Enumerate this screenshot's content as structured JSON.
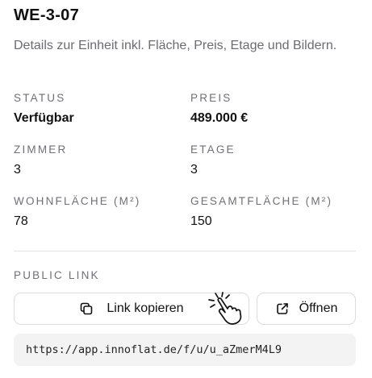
{
  "unit": {
    "title": "WE-3-07",
    "description": "Details zur Einheit inkl. Fläche, Preis, Etage und Bildern."
  },
  "fields": {
    "status": {
      "label": "STATUS",
      "value": "Verfügbar"
    },
    "price": {
      "label": "PREIS",
      "value": "489.000 €"
    },
    "rooms": {
      "label": "ZIMMER",
      "value": "3"
    },
    "floor": {
      "label": "ETAGE",
      "value": "3"
    },
    "living_area": {
      "label": "WOHNFLÄCHE (M²)",
      "value": "78"
    },
    "total_area": {
      "label": "GESAMTFLÄCHE (M²)",
      "value": "150"
    }
  },
  "public_link": {
    "label": "PUBLIC LINK",
    "copy_label": "Link kopieren",
    "open_label": "Öffnen",
    "url": "https://app.innoflat.de/f/u/u_aZmerM4L9"
  },
  "icons": {
    "copy": "copy-icon",
    "open": "external-link-icon",
    "cursor": "hand-pointer-click-icon"
  },
  "colors": {
    "text": "#111111",
    "muted": "#6b6b70",
    "border": "#dcdce0",
    "url_background": "#f3f3f4"
  }
}
